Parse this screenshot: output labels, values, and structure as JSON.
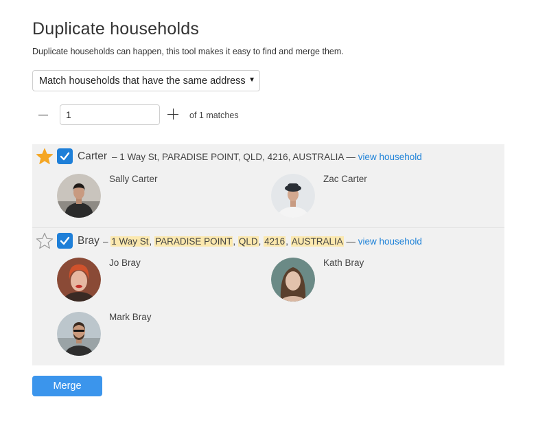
{
  "page": {
    "title": "Duplicate households",
    "subtitle": "Duplicate households can happen, this tool makes it easy to find and merge them."
  },
  "match_select": {
    "selected": "Match households that have the same address",
    "caret": "▼"
  },
  "pager": {
    "minus": "—",
    "value": "1",
    "of_label": "of 1 matches"
  },
  "households": [
    {
      "name": "Carter",
      "starred": true,
      "checked": true,
      "dash": "–",
      "address": "1 Way St, PARADISE POINT, QLD, 4216, AUSTRALIA",
      "separator": "—",
      "link_label": "view household",
      "members": [
        "Sally Carter",
        "Zac Carter"
      ]
    },
    {
      "name": "Bray",
      "starred": false,
      "checked": true,
      "dash": "–",
      "address_parts": [
        "1 Way St",
        "PARADISE POINT",
        "QLD",
        "4216",
        "AUSTRALIA"
      ],
      "address_sep": ", ",
      "separator": "—",
      "link_label": "view household",
      "members": [
        "Jo Bray",
        "Kath Bray",
        "Mark Bray"
      ]
    }
  ],
  "merge_button": {
    "label": "Merge"
  },
  "colors": {
    "accent": "#1e7fd8",
    "link": "#1e82d8",
    "star_filled": "#f5a623",
    "highlight": "#fbe8ae",
    "panel": "#f1f1f1",
    "merge_button": "#3b95ec"
  }
}
